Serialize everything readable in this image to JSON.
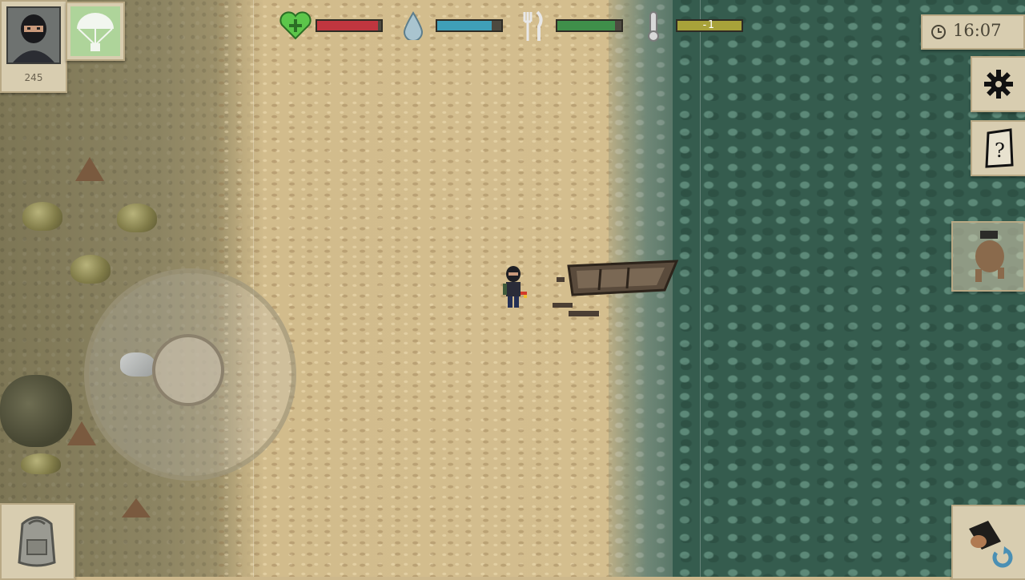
{
  "hud": {
    "health_value": 0.95,
    "water_value": 0.85,
    "food_value": 0.9,
    "temperature_label": "-1",
    "colors": {
      "health": "#c0363f",
      "water": "#3f9fb8",
      "food": "#3f8f4a",
      "temperature": "#a8a23a"
    }
  },
  "player": {
    "score": "245"
  },
  "clock": {
    "time": "16:07"
  },
  "icons": {
    "health": "heart-plus-icon",
    "water": "water-drop-icon",
    "food": "fork-knife-icon",
    "temperature": "thermometer-icon",
    "airdrop": "parachute-icon",
    "settings": "gear-icon",
    "quests": "notepad-question-icon",
    "companion": "dog-icon",
    "inventory": "backpack-icon",
    "swap_weapon": "swap-weapon-icon",
    "clock": "clock-icon"
  }
}
